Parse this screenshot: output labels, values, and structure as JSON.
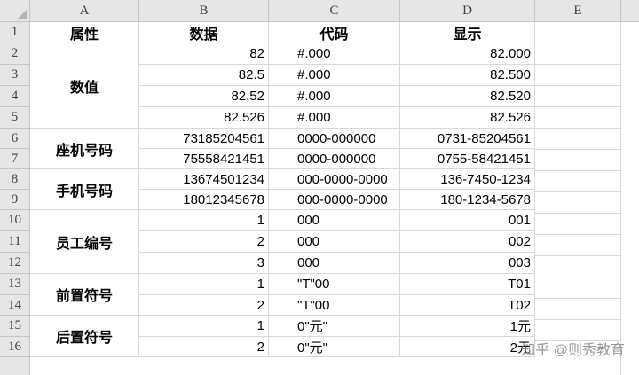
{
  "columns": [
    "A",
    "B",
    "C",
    "D",
    "E"
  ],
  "rows": [
    "1",
    "2",
    "3",
    "4",
    "5",
    "6",
    "7",
    "8",
    "9",
    "10",
    "11",
    "12",
    "13",
    "14",
    "15",
    "16"
  ],
  "header": {
    "attr": "属性",
    "data": "数据",
    "code": "代码",
    "display": "显示"
  },
  "groups": [
    {
      "label": "数值"
    },
    {
      "label": "座机号码"
    },
    {
      "label": "手机号码"
    },
    {
      "label": "员工编号"
    },
    {
      "label": "前置符号"
    },
    {
      "label": "后置符号"
    }
  ],
  "table": [
    {
      "data": "82",
      "code": "#.000",
      "display": "82.000"
    },
    {
      "data": "82.5",
      "code": "#.000",
      "display": "82.500"
    },
    {
      "data": "82.52",
      "code": "#.000",
      "display": "82.520"
    },
    {
      "data": "82.526",
      "code": "#.000",
      "display": "82.526"
    },
    {
      "data": "73185204561",
      "code": "0000-000000",
      "display": "0731-85204561"
    },
    {
      "data": "75558421451",
      "code": "0000-000000",
      "display": "0755-58421451"
    },
    {
      "data": "13674501234",
      "code": "000-0000-0000",
      "display": "136-7450-1234"
    },
    {
      "data": "18012345678",
      "code": "000-0000-0000",
      "display": "180-1234-5678"
    },
    {
      "data": "1",
      "code": "000",
      "display": "001"
    },
    {
      "data": "2",
      "code": "000",
      "display": "002"
    },
    {
      "data": "3",
      "code": "000",
      "display": "003"
    },
    {
      "data": "1",
      "code": "\"T\"00",
      "display": "T01"
    },
    {
      "data": "2",
      "code": "\"T\"00",
      "display": "T02"
    },
    {
      "data": "1",
      "code": "0\"元\"",
      "display": "1元"
    },
    {
      "data": "2",
      "code": "0\"元\"",
      "display": "2元"
    }
  ],
  "watermark": "知乎 @则秀教育"
}
